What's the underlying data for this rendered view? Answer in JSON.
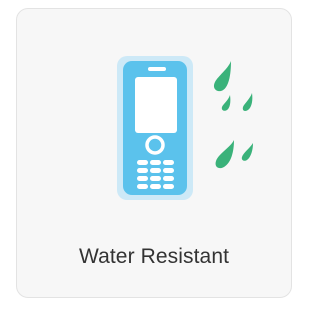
{
  "feature": {
    "label": "Water Resistant",
    "icon": "water-resistant-phone-icon"
  },
  "colors": {
    "card_background": "#f7f7f7",
    "card_border": "#e3e3e3",
    "phone_glow": "#cde9f7",
    "phone_body": "#5bc2ec",
    "phone_screen": "#ffffff",
    "water_drops": "#3ab27a",
    "label_text": "#333333"
  }
}
